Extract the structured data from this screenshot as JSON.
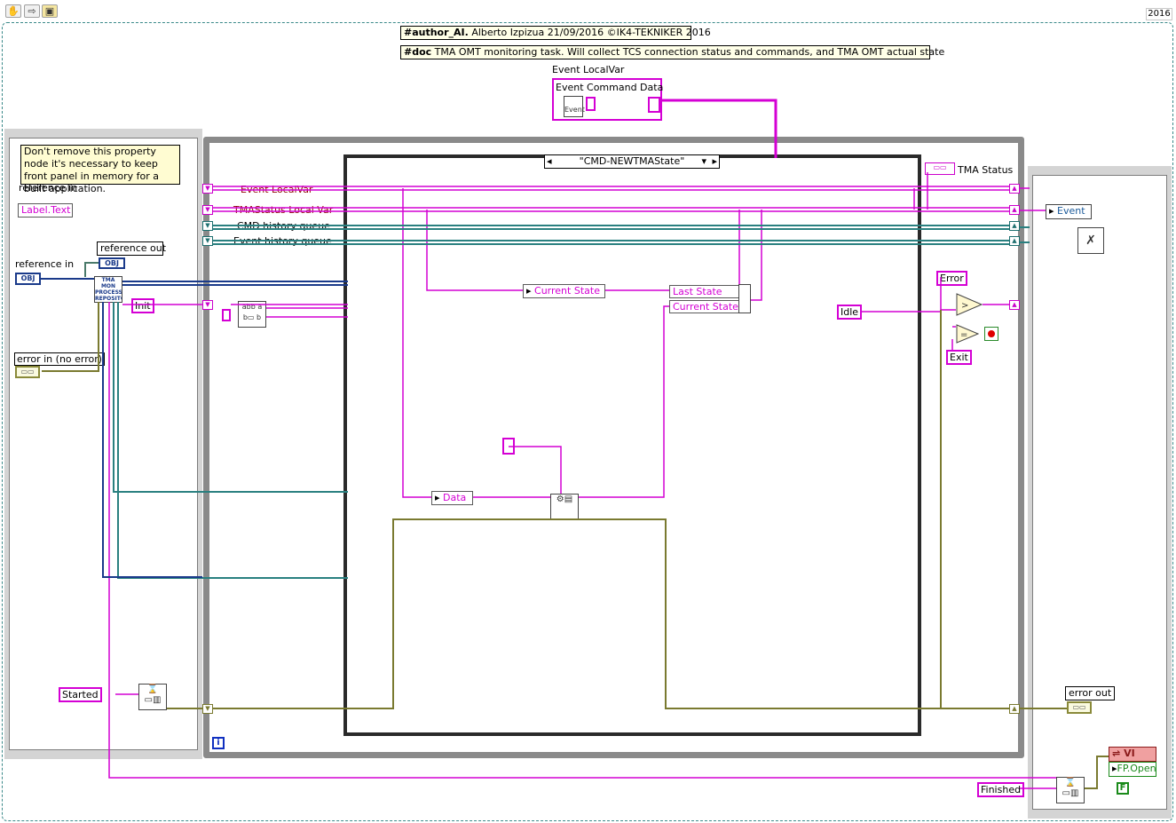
{
  "toolbar": {
    "tools": [
      "hand-icon",
      "arrow-icon",
      "labview-icon"
    ],
    "version": "2016"
  },
  "comments": {
    "author_tag": "#author_AI.",
    "author_text": "Alberto Izpizua 21/09/2016 ©IK4-TEKNIKER 2016",
    "doc_tag": "#doc",
    "doc_text": "TMA OMT monitoring task. Will collect TCS connection status and commands, and TMA OMT actual state",
    "property_note": "Don't remove this property node it's necessary to keep front panel in memory for a built application."
  },
  "event_cluster": {
    "local_var_label": "Event LocalVar",
    "command_label": "Event Command Data",
    "event_icon_text": "Event"
  },
  "left_frame": {
    "ref_in_label": "reference in",
    "property_label": "Label.Text",
    "ref_out_label": "reference out",
    "ref_in2_label": "reference in",
    "obj_text": "OBJ",
    "subvi_text": "TMA MON PROCESS REPOSITO",
    "error_in_label": "error in (no error)",
    "init_const": "Init",
    "started_const": "Started"
  },
  "shift_registers": {
    "event_local": "Event LocalVar",
    "tma_status_local": "TMAStatus Local Var",
    "cmd_history": "CMD history queue",
    "event_history": "Event history queue"
  },
  "case_structure": {
    "selector": "\"CMD-NEWTMAState\"",
    "current_state_1": "Current State",
    "last_state": "Last State",
    "current_state_2": "Current State",
    "data_label": "Data"
  },
  "right_logic": {
    "tma_status": "TMA Status",
    "error_const": "Error",
    "idle_const": "Idle",
    "exit_const": "Exit",
    "iteration": "i"
  },
  "right_frame": {
    "event_label": "Event",
    "error_out_label": "error out",
    "finished_const": "Finished",
    "vi_label": "VI",
    "fp_open_label": "FP.Open",
    "false_const": "F"
  }
}
